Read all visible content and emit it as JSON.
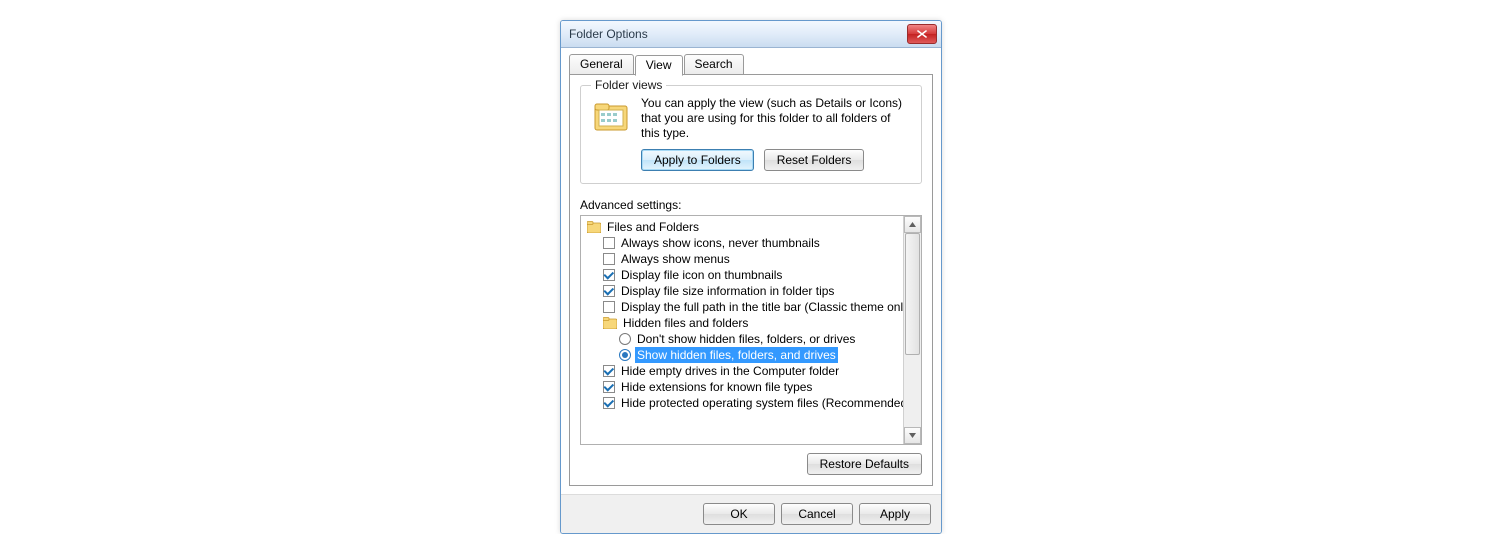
{
  "dialog": {
    "title": "Folder Options"
  },
  "tabs": {
    "general": "General",
    "view": "View",
    "search": "Search"
  },
  "folderViews": {
    "group_title": "Folder views",
    "description": "You can apply the view (such as Details or Icons) that you are using for this folder to all folders of this type.",
    "apply_button": "Apply to Folders",
    "reset_button": "Reset Folders"
  },
  "advanced": {
    "label": "Advanced settings:",
    "root": "Files and Folders",
    "items": {
      "always_icons": "Always show icons, never thumbnails",
      "always_menus": "Always show menus",
      "display_icon_thumb": "Display file icon on thumbnails",
      "display_size_tips": "Display file size information in folder tips",
      "display_full_path": "Display the full path in the title bar (Classic theme only)",
      "hidden_group": "Hidden files and folders",
      "dont_show_hidden": "Don't show hidden files, folders, or drives",
      "show_hidden": "Show hidden files, folders, and drives",
      "hide_empty_drives": "Hide empty drives in the Computer folder",
      "hide_extensions": "Hide extensions for known file types",
      "hide_protected": "Hide protected operating system files (Recommended)"
    },
    "restore_button": "Restore Defaults"
  },
  "buttons": {
    "ok": "OK",
    "cancel": "Cancel",
    "apply": "Apply"
  }
}
